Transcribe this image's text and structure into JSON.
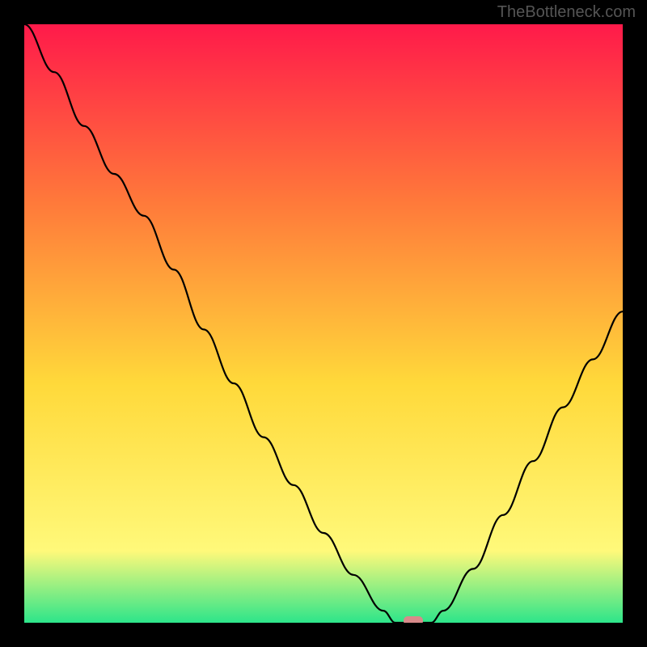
{
  "watermark": "TheBottleneck.com",
  "chart_data": {
    "type": "line",
    "title": "",
    "xlabel": "",
    "ylabel": "",
    "x": [
      0,
      5,
      10,
      15,
      20,
      25,
      30,
      35,
      40,
      45,
      50,
      55,
      60,
      62,
      64,
      66,
      68,
      70,
      75,
      80,
      85,
      90,
      95,
      100
    ],
    "values": [
      100,
      92,
      83,
      75,
      68,
      59,
      49,
      40,
      31,
      23,
      15,
      8,
      2,
      0,
      0,
      0,
      0,
      2,
      9,
      18,
      27,
      36,
      44,
      52
    ],
    "xlim": [
      0,
      100
    ],
    "ylim": [
      0,
      100
    ],
    "gradient_colors": {
      "top": "#ff1a4a",
      "upper_mid": "#ff7a3a",
      "mid": "#ffd93a",
      "lower_mid": "#fff97a",
      "bottom": "#2de58a"
    },
    "marker": {
      "x": 65,
      "y": 0,
      "color": "#d88a8a"
    }
  }
}
